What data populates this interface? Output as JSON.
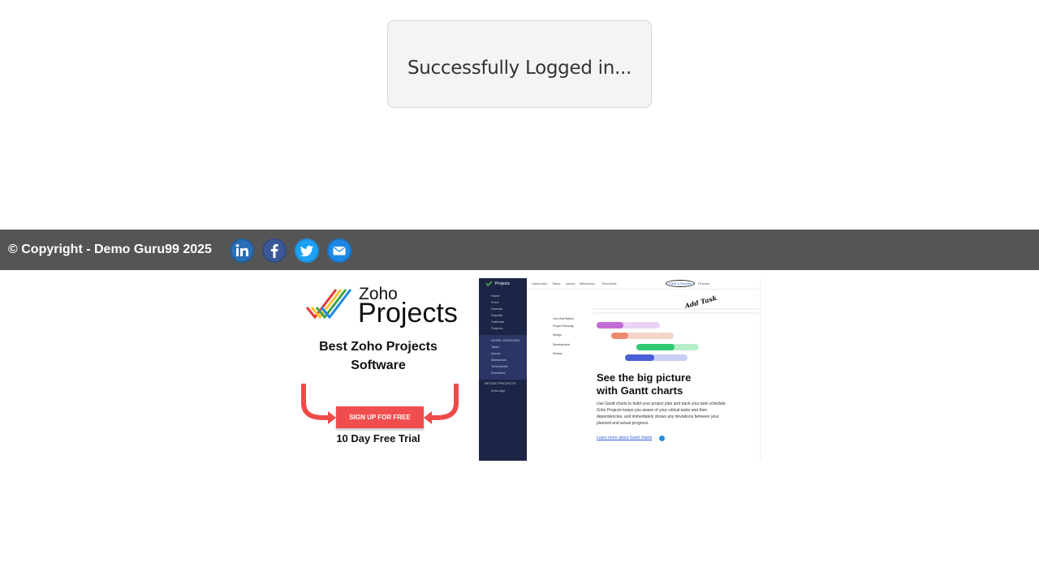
{
  "login": {
    "message": "Successfully Logged in..."
  },
  "footer": {
    "copyright": "© Copyright - Demo Guru99 2025",
    "social": [
      {
        "name": "linkedin",
        "glyph": "in",
        "color": "#2a6fb6"
      },
      {
        "name": "facebook",
        "glyph": "f",
        "color": "#3b5998"
      },
      {
        "name": "twitter",
        "glyph": "t",
        "color": "#1da1f2"
      },
      {
        "name": "email",
        "glyph": "✉",
        "color": "#1e88e5"
      }
    ],
    "background": "#555555"
  },
  "ad_left": {
    "brand_small": "Zoho",
    "brand_big": "Projects",
    "title_line1": "Best Zoho Projects",
    "title_line2": "Software",
    "cta": "SIGN UP FOR FREE",
    "trial": "10 Day Free Trial",
    "cta_color": "#f04e4e"
  },
  "ad_right": {
    "app_title": "Projects",
    "sidebar": [
      "Home",
      "Feed",
      "Discuss",
      "Reports",
      "Calendar",
      "Projects"
    ],
    "work_overview": "WORK OVERVIEW",
    "work_items": [
      "Tasks",
      "Issues",
      "Milestones",
      "Timesheets",
      "Exercises"
    ],
    "recent_projects": "RECENT PROJECTS",
    "recent_item": "Zoho App",
    "tabs": [
      "Dashboard",
      "Tasks",
      "Issues",
      "Milestones",
      "Timesheet"
    ],
    "active_tab": "Gantt & Reports",
    "extra_tab": "Finance",
    "rows": [
      "Live chat feature",
      "Project Planning",
      "Design",
      "Development",
      "Review"
    ],
    "add_task": "Add Task",
    "headline_1": "See the big picture",
    "headline_2": "with Gantt charts",
    "description": "Use Gantt charts to build your project plan and track your task schedule. Zoho Projects keeps you aware of your critical tasks and their dependencies, and immediately shows any deviations between your planned and actual progress.",
    "link": "Learn more about Gantt charts",
    "bar_colors": [
      "#c36ad6",
      "#ee8a6c",
      "#2ecc71",
      "#4a5fd6"
    ]
  }
}
